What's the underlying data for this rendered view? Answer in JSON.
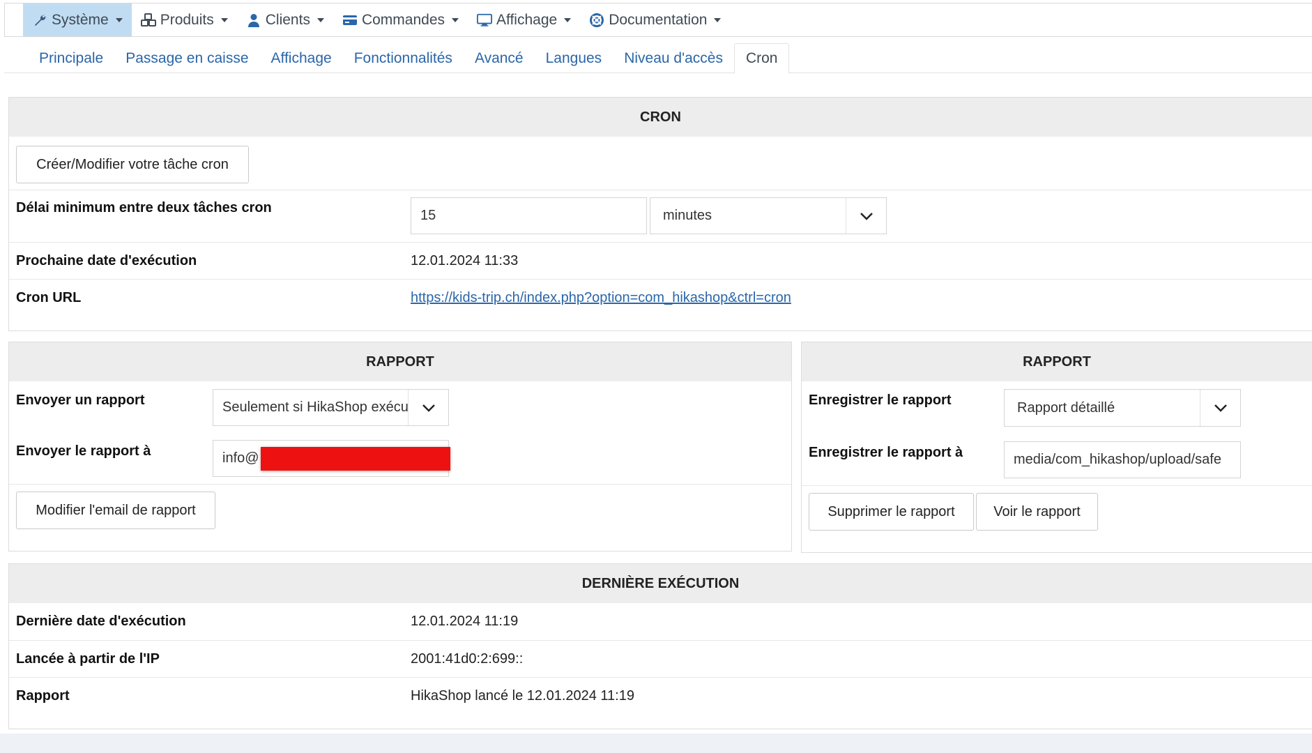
{
  "menu": {
    "items": [
      {
        "label": "Système",
        "icon": "wrench-icon",
        "active": true
      },
      {
        "label": "Produits",
        "icon": "cubes-icon",
        "active": false
      },
      {
        "label": "Clients",
        "icon": "user-icon",
        "active": false
      },
      {
        "label": "Commandes",
        "icon": "credit-card-icon",
        "active": false
      },
      {
        "label": "Affichage",
        "icon": "monitor-icon",
        "active": false
      },
      {
        "label": "Documentation",
        "icon": "lifebuoy-icon",
        "active": false
      }
    ]
  },
  "tabs": [
    {
      "label": "Principale"
    },
    {
      "label": "Passage en caisse"
    },
    {
      "label": "Affichage"
    },
    {
      "label": "Fonctionnalités"
    },
    {
      "label": "Avancé"
    },
    {
      "label": "Langues"
    },
    {
      "label": "Niveau d'accès"
    },
    {
      "label": "Cron",
      "active": true
    }
  ],
  "cron": {
    "title": "CRON",
    "create_button": "Créer/Modifier votre tâche cron",
    "delay_label": "Délai minimum entre deux tâches cron",
    "delay_value": "15",
    "delay_unit": "minutes",
    "next_label": "Prochaine date d'exécution",
    "next_value": "12.01.2024 11:33",
    "url_label": "Cron URL",
    "url_value": "https://kids-trip.ch/index.php?option=com_hikashop&ctrl=cron"
  },
  "report_left": {
    "title": "RAPPORT",
    "send_label": "Envoyer un rapport",
    "send_value": "Seulement si HikaShop exécute",
    "send_to_label": "Envoyer le rapport à",
    "send_to_value": "info@",
    "modify_button": "Modifier l'email de rapport"
  },
  "report_right": {
    "title": "RAPPORT",
    "save_label": "Enregistrer le rapport",
    "save_value": "Rapport détaillé",
    "save_to_label": "Enregistrer le rapport à",
    "save_to_value": "media/com_hikashop/upload/safe",
    "delete_button": "Supprimer le rapport",
    "view_button": "Voir le rapport"
  },
  "last_run": {
    "title": "DERNIÈRE EXÉCUTION",
    "date_label": "Dernière date d'exécution",
    "date_value": "12.01.2024 11:19",
    "ip_label": "Lancée à partir de l'IP",
    "ip_value": "2001:41d0:2:699::",
    "report_label": "Rapport",
    "report_value": "HikaShop lancé le 12.01.2024 11:19"
  },
  "colors": {
    "accent": "#2a66a8",
    "active_menu": "#bfdcf2",
    "panel_header": "#ededed",
    "redaction": "#ee1111"
  }
}
